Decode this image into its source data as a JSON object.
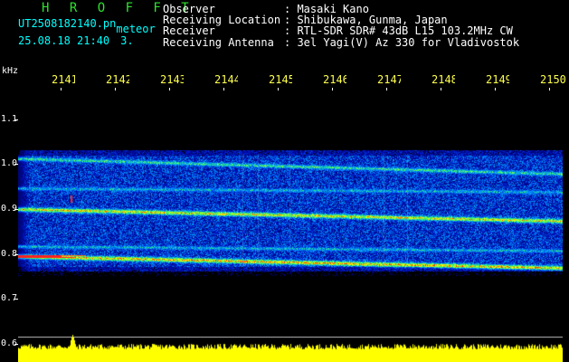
{
  "header": {
    "station": "H R O F F T",
    "filename": "UT2508182140.pn",
    "category": "meteor",
    "date": "25.08.18 21:40",
    "count": "3."
  },
  "info": [
    {
      "label": "Observer",
      "value": ": Masaki Kano"
    },
    {
      "label": "Receiving Location",
      "value": ": Shibukawa, Gunma, Japan"
    },
    {
      "label": "Receiver",
      "value": ": RTL-SDR SDR# 43dB L15 103.2MHz CW"
    },
    {
      "label": "Receiving Antenna",
      "value": ": 3el Yagi(V) Az 330 for Vladivostok"
    }
  ],
  "axis": {
    "y_unit": "kHz",
    "y_ticks": [
      "1.1",
      "1.0",
      "0.9",
      "0.8",
      "0.7",
      "0.6"
    ],
    "x_ticks": [
      "2141",
      "2142",
      "2143",
      "2144",
      "2145",
      "2146",
      "2147",
      "2148",
      "2149",
      "2150"
    ]
  },
  "colors": {
    "label_green": "#2fe22f",
    "label_cyan": "#00ffff",
    "tick_yellow": "#ffff4d",
    "noise_blue": "#1a3cff",
    "echo_red": "#ff2020",
    "signal_yellow": "#ffff00"
  }
}
